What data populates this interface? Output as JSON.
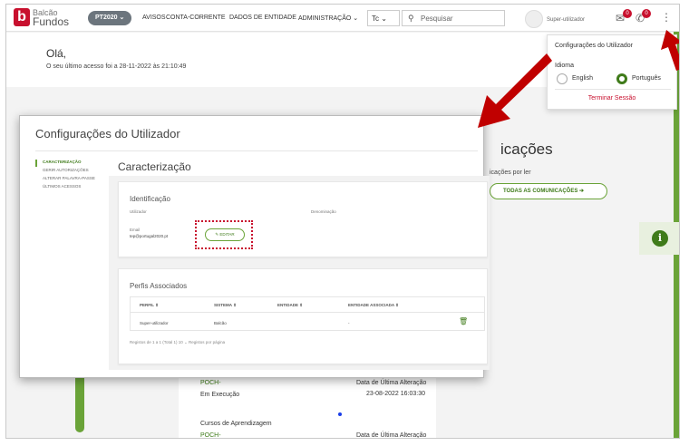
{
  "logo": {
    "mark": "b",
    "line1": "Balcão",
    "line2": "Fundos"
  },
  "nav": {
    "program": "PT2020 ⌄",
    "links": [
      "AVISOS",
      "CONTA-CORRENTE",
      "DADOS DE ENTIDADE",
      "ADMINISTRAÇÃO ⌄"
    ],
    "tc": "Tc ⌄",
    "search_placeholder": "Pesquisar",
    "user": "Super-utilizador",
    "mail_count": "0",
    "bell_count": "0"
  },
  "greeting": {
    "title": "Olá,",
    "last_access": "O seu último acesso foi a 28-11-2022 às 21:10:49"
  },
  "dropdown": {
    "title": "Configurações do Utilizador",
    "language_label": "Idioma",
    "options": [
      "English",
      "Português"
    ],
    "selected": "Português",
    "logout": "Terminar Sessão"
  },
  "background": {
    "section_title": "icações",
    "sub": "icações por ler",
    "button": "TODAS AS COMUNICAÇÕES ➔",
    "card": {
      "r1_left": "POCH-",
      "r1_right": "Data de Última Alteração",
      "r2_left": "Em Execução",
      "r2_right": "23-08-2022 16:03:30",
      "r3_left": "Cursos de Aprendizagem",
      "r4_left": "POCH-",
      "r4_right": "Data de Última Alteração"
    }
  },
  "modal": {
    "title": "Configurações do Utilizador",
    "sidebar": [
      "CARACTERIZAÇÃO",
      "GERIR AUTORIZAÇÕES",
      "ALTERAR PALAVRA-PASSE",
      "ÚLTIMOS ACESSOS"
    ],
    "heading": "Caracterização",
    "identificacao": {
      "title": "Identificação",
      "utilizador_label": "Utilizador",
      "denominacao_label": "Denominação",
      "email_label": "Email",
      "email_value": "tep@portugal2020.pt",
      "edit_button": "✎ EDITAR"
    },
    "perfis": {
      "title": "Perfis Associados",
      "columns": [
        "PERFIL ⇕",
        "SISTEMA ⇕",
        "ENTIDADE ⇕",
        "ENTIDADE ASSOCIADA ⇕"
      ],
      "row": [
        "Super-utilizador",
        "Balcão",
        "",
        "-"
      ],
      "footer": "Registos de 1 a 1 (Total 1)    10 ⌄  Registos por página"
    }
  },
  "colors": {
    "brand_red": "#c8102e",
    "accent_green": "#6aa338",
    "dark_green": "#3f7b1a"
  }
}
